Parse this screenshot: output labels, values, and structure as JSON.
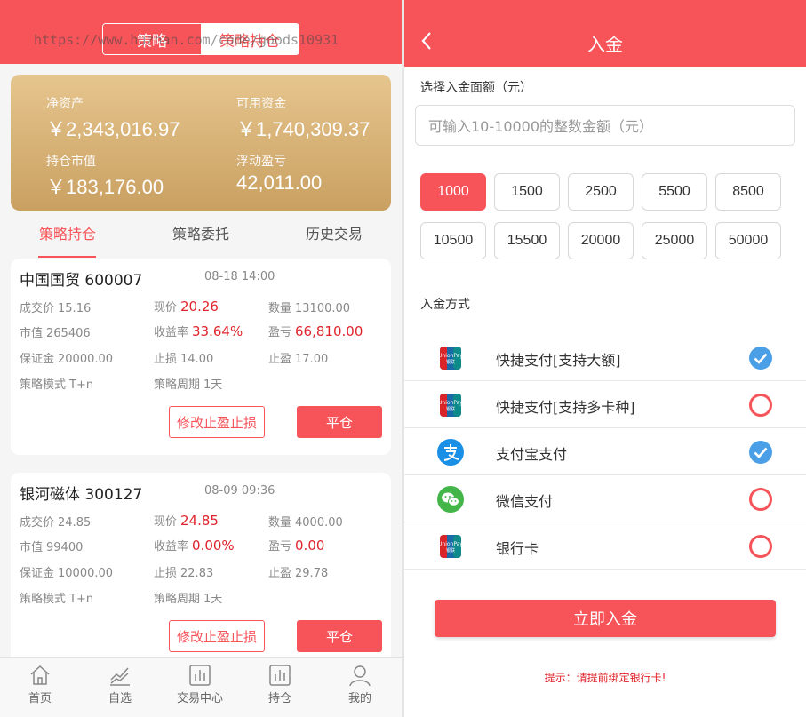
{
  "colors": {
    "accent": "#f7545a",
    "gold_top": "#e6c58e",
    "gold_bottom": "#c9a061",
    "profit_red": "#e0242c",
    "check_blue": "#4a9fe6",
    "alipay_blue": "#1a8fe6",
    "wechat_green": "#44b549"
  },
  "left": {
    "segment": {
      "strategy": "策略",
      "holdings": "策略持仓"
    },
    "watermark": "https://www.huzhan.com/code/goods10931",
    "summary": {
      "net_assets_label": "净资产",
      "net_assets": "￥2,343,016.97",
      "available_label": "可用资金",
      "available": "￥1,740,309.37",
      "market_value_label": "持仓市值",
      "market_value": "￥183,176.00",
      "floating_pl_label": "浮动盈亏",
      "floating_pl": "42,011.00"
    },
    "tabs": [
      "策略持仓",
      "策略委托",
      "历史交易"
    ],
    "labels": {
      "deal_price": "成交价",
      "current_price": "现价",
      "quantity": "数量",
      "market_value": "市值",
      "yield": "收益率",
      "pl": "盈亏",
      "margin": "保证金",
      "stop_loss": "止损",
      "take_profit": "止盈",
      "mode": "策略模式",
      "period": "策略周期"
    },
    "positions": [
      {
        "name": "中国国贸 600007",
        "time": "08-18 14:00",
        "deal_price": "15.16",
        "current_price": "20.26",
        "quantity": "13100.00",
        "market_value": "265406",
        "yield": "33.64%",
        "pl": "66,810.00",
        "margin": "20000.00",
        "stop_loss": "14.00",
        "take_profit": "17.00",
        "mode": "T+n",
        "period": "1天",
        "modify_label": "修改止盈止损",
        "close_label": "平仓"
      },
      {
        "name": "银河磁体 300127",
        "time": "08-09 09:36",
        "deal_price": "24.85",
        "current_price": "24.85",
        "quantity": "4000.00",
        "market_value": "99400",
        "yield": "0.00%",
        "pl": "0.00",
        "margin": "10000.00",
        "stop_loss": "22.83",
        "take_profit": "29.78",
        "mode": "T+n",
        "period": "1天",
        "modify_label": "修改止盈止损",
        "close_label": "平仓"
      }
    ],
    "nav": [
      {
        "label": "首页",
        "icon": "home-icon"
      },
      {
        "label": "自选",
        "icon": "trend-chart-icon"
      },
      {
        "label": "交易中心",
        "icon": "bar-chart-icon"
      },
      {
        "label": "持仓",
        "icon": "bar-chart-icon"
      },
      {
        "label": "我的",
        "icon": "user-icon"
      }
    ]
  },
  "right": {
    "title": "入金",
    "amount_section_label": "选择入金面额（元）",
    "amount_placeholder": "可输入10-10000的整数金额（元）",
    "amounts": [
      "1000",
      "1500",
      "2500",
      "5500",
      "8500",
      "10500",
      "15500",
      "20000",
      "25000",
      "50000"
    ],
    "selected_amount": "1000",
    "method_section_label": "入金方式",
    "methods": [
      {
        "label": "快捷支付[支持大额]",
        "icon": "unionpay-icon",
        "checked": true
      },
      {
        "label": "快捷支付[支持多卡种]",
        "icon": "unionpay-icon",
        "checked": false
      },
      {
        "label": "支付宝支付",
        "icon": "alipay-icon",
        "checked": true
      },
      {
        "label": "微信支付",
        "icon": "wechat-icon",
        "checked": false
      },
      {
        "label": "银行卡",
        "icon": "unionpay-icon",
        "checked": false
      }
    ],
    "submit_label": "立即入金",
    "tip": "提示：请提前绑定银行卡!"
  }
}
